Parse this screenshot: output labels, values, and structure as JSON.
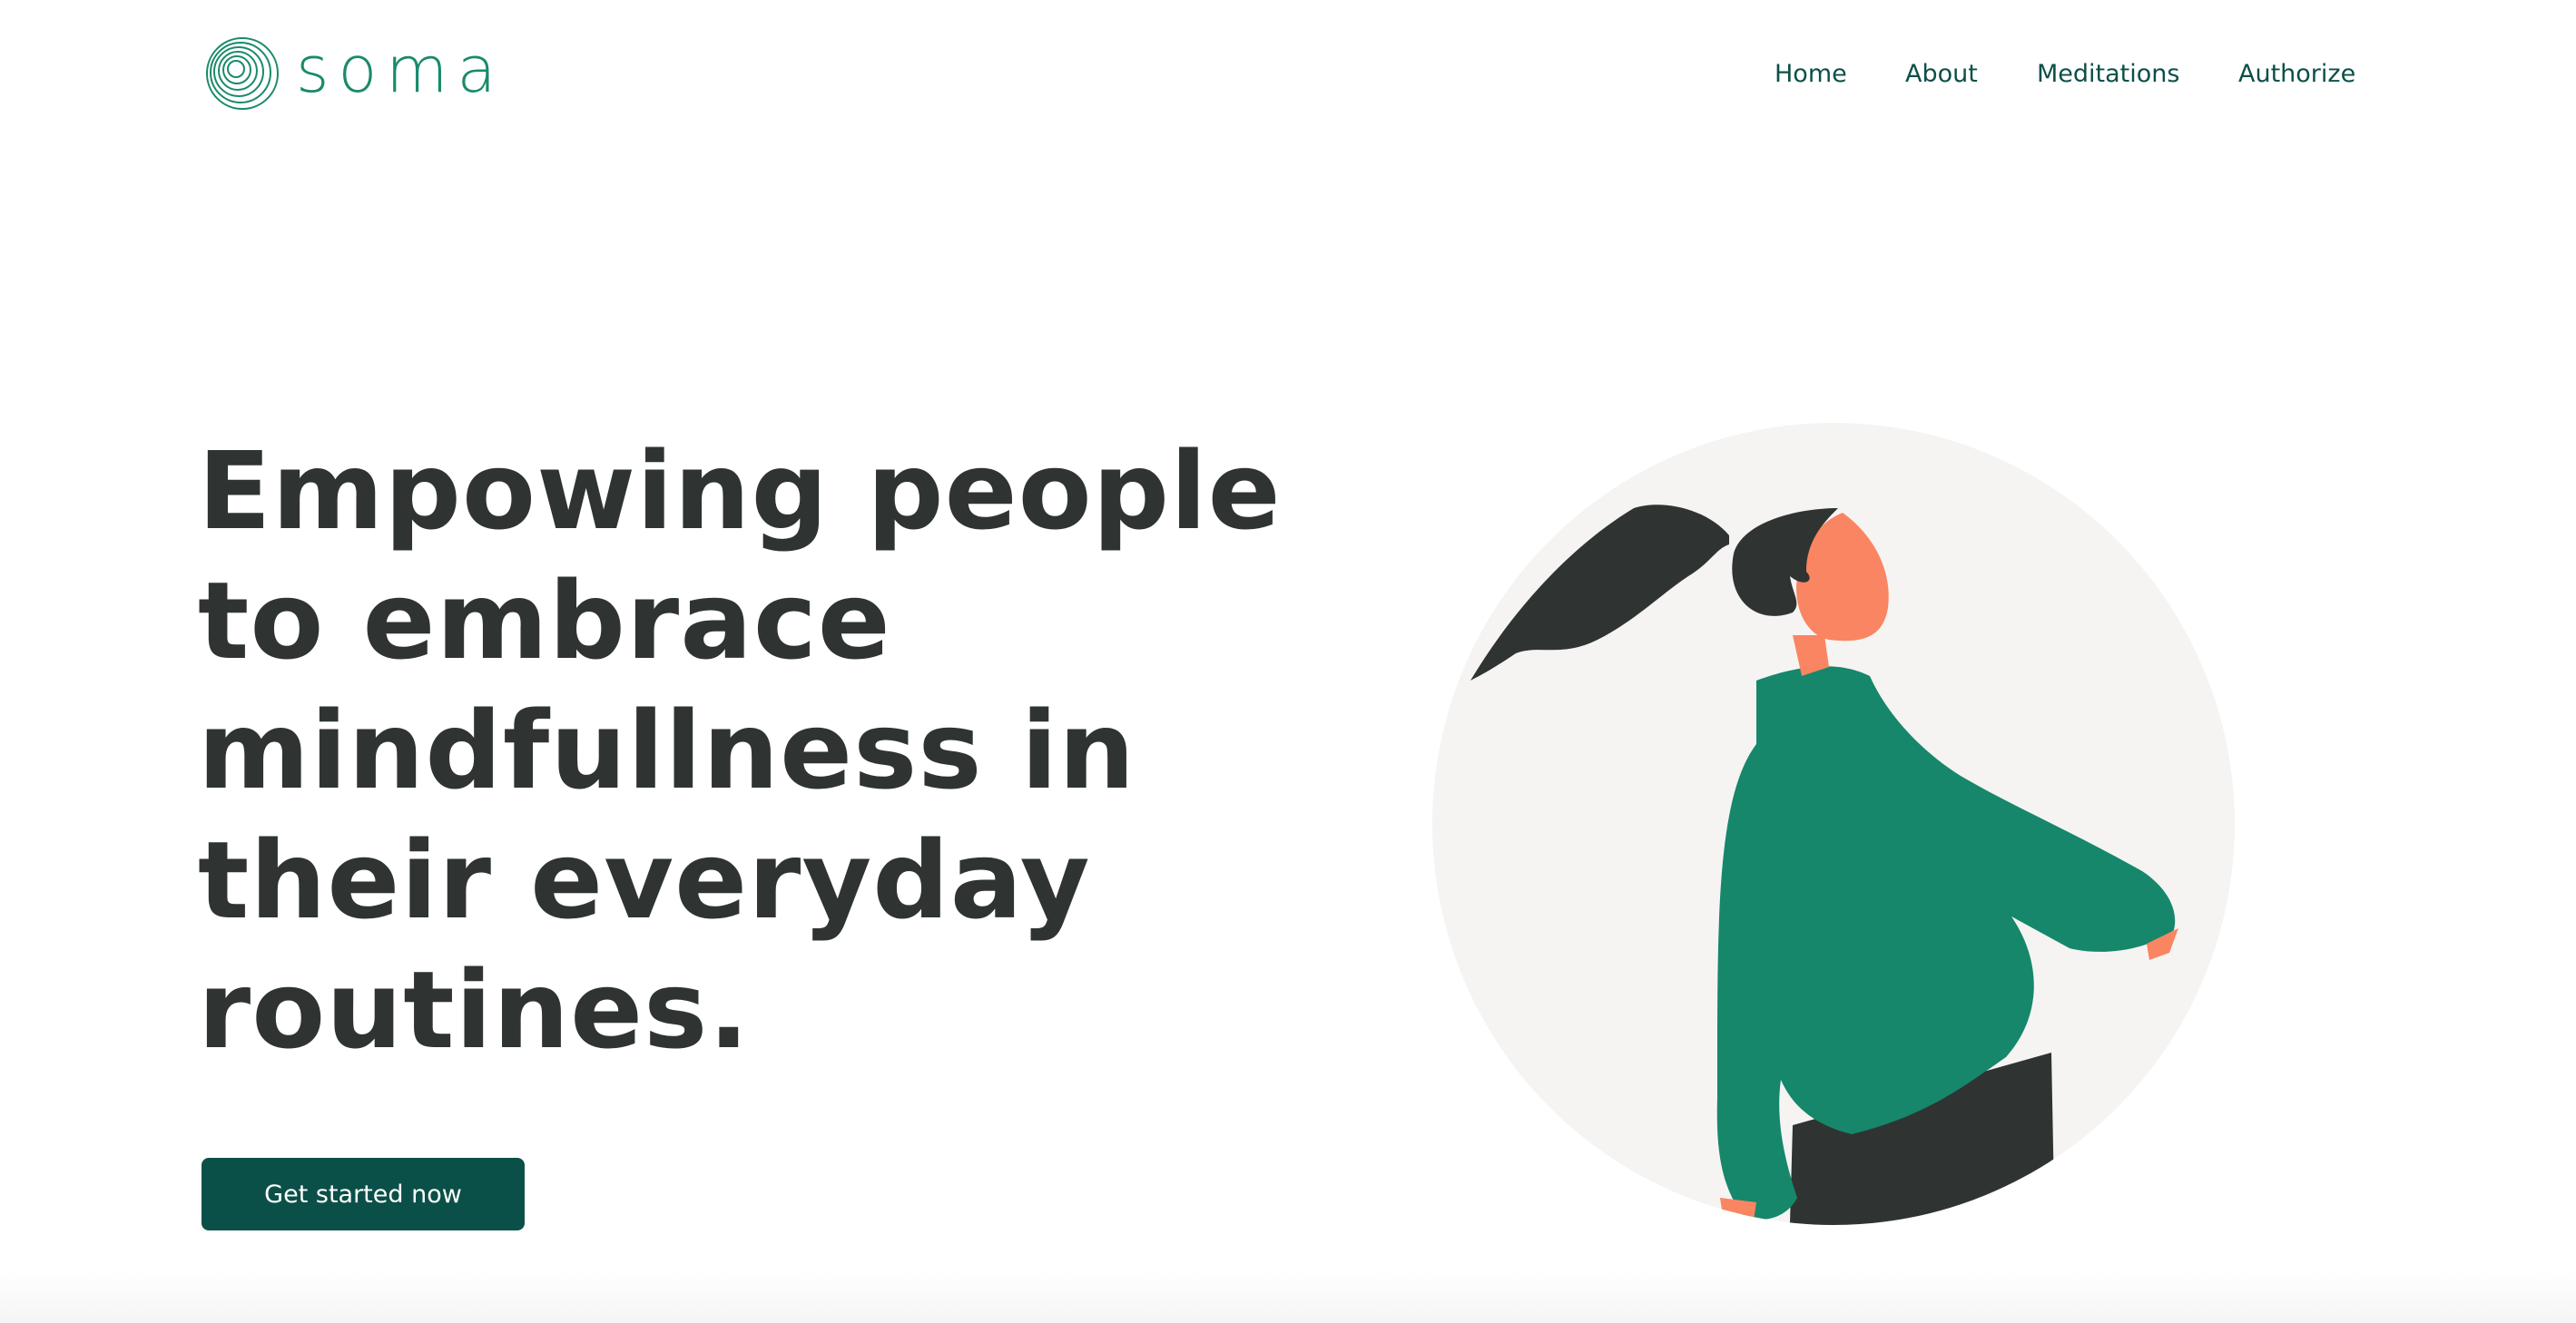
{
  "brand": {
    "name": "soma",
    "logo_icon": "concentric-circles-icon",
    "color": "#1a8a6b"
  },
  "nav": {
    "items": [
      {
        "label": "Home"
      },
      {
        "label": "About"
      },
      {
        "label": "Meditations"
      },
      {
        "label": "Authorize"
      }
    ]
  },
  "hero": {
    "title": "Empowing people to embrace mindfullness in their everyday routines.",
    "cta_label": "Get started now",
    "illustration_icon": "woman-with-ponytail-illustration"
  },
  "colors": {
    "primary": "#0b5048",
    "accent": "#16876a",
    "text": "#2f3433",
    "skin": "#fa8562",
    "circle_bg": "#f5f4f2"
  }
}
